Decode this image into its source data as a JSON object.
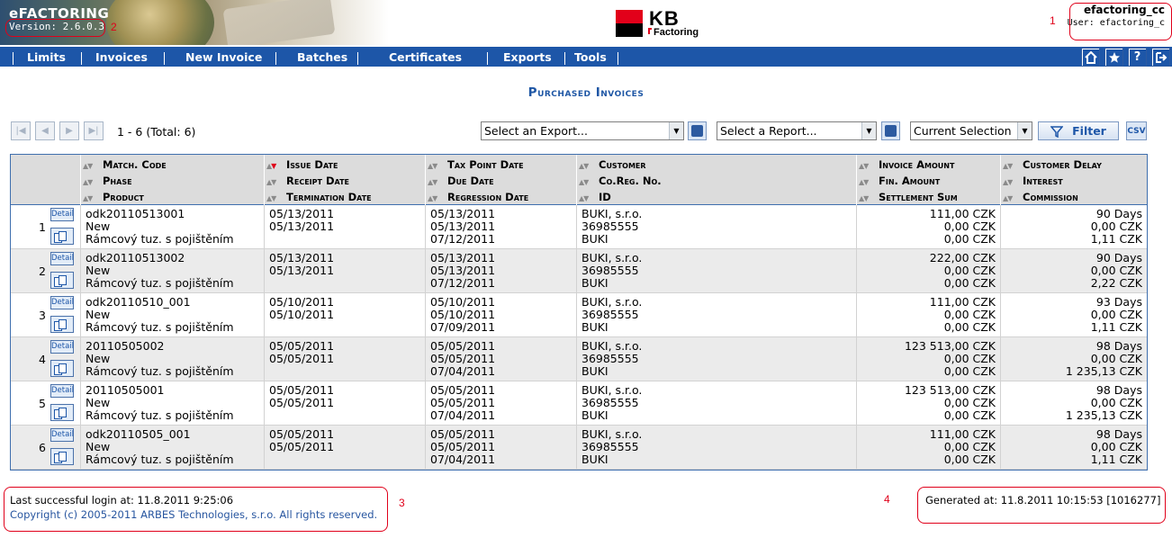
{
  "header": {
    "app_name": "eFACTORING",
    "version": "Version: 2.6.0.3",
    "logo": {
      "main": "KB",
      "sub": "Factoring",
      "brand_red": "#e2001a"
    },
    "user": {
      "name": "efactoring_cc",
      "label": "User: efactoring_c"
    }
  },
  "annotations": [
    "1",
    "2",
    "3",
    "4"
  ],
  "nav": {
    "items": [
      "Limits",
      "Invoices",
      "New Invoice",
      "Batches",
      "Certificates",
      "Exports",
      "Tools"
    ],
    "icons": [
      "home-icon",
      "favorites-icon",
      "help-icon",
      "logout-icon"
    ],
    "help_glyph": "?"
  },
  "page": {
    "title": "Purchased Invoices"
  },
  "toolbar": {
    "pager_info": "1 - 6 (Total: 6)",
    "export_select": "Select an Export...",
    "report_select": "Select a Report...",
    "selection_select": "Current Selection",
    "filter_label": "Filter",
    "csv_label": "CSV"
  },
  "table": {
    "columns": [
      [
        "Match. Code",
        "Phase",
        "Product"
      ],
      [
        "Issue Date",
        "Receipt Date",
        "Termination Date"
      ],
      [
        "Tax Point Date",
        "Due Date",
        "Regression Date"
      ],
      [
        "Customer",
        "Co.Reg. No.",
        "ID"
      ],
      [
        "Invoice Amount",
        "Fin. Amount",
        "Settlement Sum"
      ],
      [
        "Customer Delay",
        "Interest",
        "Commission"
      ]
    ],
    "detail_label": "Detail",
    "rows": [
      {
        "num": "1",
        "c1": [
          "odk20110513001",
          "New",
          "Rámcový tuz. s pojištěním"
        ],
        "c2": [
          "05/13/2011",
          "05/13/2011",
          ""
        ],
        "c3": [
          "05/13/2011",
          "05/13/2011",
          "07/12/2011"
        ],
        "c4": [
          "BUKI, s.r.o.",
          "36985555",
          "BUKI"
        ],
        "c5": [
          "111,00 CZK",
          "0,00 CZK",
          "0,00 CZK"
        ],
        "c6": [
          "90 Days",
          "0,00 CZK",
          "1,11 CZK"
        ]
      },
      {
        "num": "2",
        "c1": [
          "odk20110513002",
          "New",
          "Rámcový tuz. s pojištěním"
        ],
        "c2": [
          "05/13/2011",
          "05/13/2011",
          ""
        ],
        "c3": [
          "05/13/2011",
          "05/13/2011",
          "07/12/2011"
        ],
        "c4": [
          "BUKI, s.r.o.",
          "36985555",
          "BUKI"
        ],
        "c5": [
          "222,00 CZK",
          "0,00 CZK",
          "0,00 CZK"
        ],
        "c6": [
          "90 Days",
          "0,00 CZK",
          "2,22 CZK"
        ]
      },
      {
        "num": "3",
        "c1": [
          "odk20110510_001",
          "New",
          "Rámcový tuz. s pojištěním"
        ],
        "c2": [
          "05/10/2011",
          "05/10/2011",
          ""
        ],
        "c3": [
          "05/10/2011",
          "05/10/2011",
          "07/09/2011"
        ],
        "c4": [
          "BUKI, s.r.o.",
          "36985555",
          "BUKI"
        ],
        "c5": [
          "111,00 CZK",
          "0,00 CZK",
          "0,00 CZK"
        ],
        "c6": [
          "93 Days",
          "0,00 CZK",
          "1,11 CZK"
        ]
      },
      {
        "num": "4",
        "c1": [
          "20110505002",
          "New",
          "Rámcový tuz. s pojištěním"
        ],
        "c2": [
          "05/05/2011",
          "05/05/2011",
          ""
        ],
        "c3": [
          "05/05/2011",
          "05/05/2011",
          "07/04/2011"
        ],
        "c4": [
          "BUKI, s.r.o.",
          "36985555",
          "BUKI"
        ],
        "c5": [
          "123 513,00 CZK",
          "0,00 CZK",
          "0,00 CZK"
        ],
        "c6": [
          "98 Days",
          "0,00 CZK",
          "1 235,13 CZK"
        ]
      },
      {
        "num": "5",
        "c1": [
          "20110505001",
          "New",
          "Rámcový tuz. s pojištěním"
        ],
        "c2": [
          "05/05/2011",
          "05/05/2011",
          ""
        ],
        "c3": [
          "05/05/2011",
          "05/05/2011",
          "07/04/2011"
        ],
        "c4": [
          "BUKI, s.r.o.",
          "36985555",
          "BUKI"
        ],
        "c5": [
          "123 513,00 CZK",
          "0,00 CZK",
          "0,00 CZK"
        ],
        "c6": [
          "98 Days",
          "0,00 CZK",
          "1 235,13 CZK"
        ]
      },
      {
        "num": "6",
        "c1": [
          "odk20110505_001",
          "New",
          "Rámcový tuz. s pojištěním"
        ],
        "c2": [
          "05/05/2011",
          "05/05/2011",
          ""
        ],
        "c3": [
          "05/05/2011",
          "05/05/2011",
          "07/04/2011"
        ],
        "c4": [
          "BUKI, s.r.o.",
          "36985555",
          "BUKI"
        ],
        "c5": [
          "111,00 CZK",
          "0,00 CZK",
          "0,00 CZK"
        ],
        "c6": [
          "98 Days",
          "0,00 CZK",
          "1,11 CZK"
        ]
      }
    ]
  },
  "footer": {
    "last_login": "Last successful login at: 11.8.2011 9:25:06",
    "copyright": "Copyright (c) 2005-2011 ARBES Technologies, s.r.o. All rights reserved.",
    "generated": "Generated at: 11.8.2011 10:15:53 [1016277]"
  }
}
